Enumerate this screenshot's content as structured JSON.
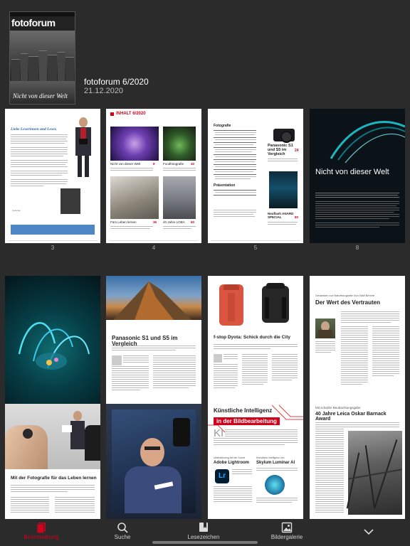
{
  "issue": {
    "title": "fotoforum 6/2020",
    "date": "21.12.2020",
    "cover": {
      "logo": "fotoforum",
      "headline": "Nicht von dieser Welt"
    }
  },
  "pages": [
    {
      "number": "3",
      "heading": "Liebe Leserinnen und Leser,"
    },
    {
      "number": "4",
      "heading": "INHALT 6/2020",
      "captions": [
        "Nicht von dieser Welt",
        "Foodfotografie",
        "Fürs Leben lernen",
        "40 Jahre LOBA"
      ],
      "caption_nums": [
        "8",
        "40",
        "36",
        "60"
      ]
    },
    {
      "number": "5",
      "heading": "Fotografie",
      "side_heading": "Panasonic S1 und S5 im Vergleich",
      "side_num": "24",
      "side_heading2": "Neuflash ANARD SPECIAL",
      "side_num2": "80",
      "sub_heading": "Präsentation"
    },
    {
      "number": "8",
      "heading": "Nicht von dieser Welt"
    },
    {
      "number": "9"
    },
    {
      "number": "24",
      "heading": "Panasonic S1 und S5 im Vergleich"
    },
    {
      "number": "28",
      "heading": "f-stop Dyota: Schick durch die City"
    },
    {
      "number": "30",
      "kicker": "Gedanken zur Naturfotografie Von Niall Benvie",
      "heading": "Der Wert des Vertrauten"
    },
    {
      "number": "",
      "heading": "Mit der Fotografie für das Leben lernen"
    },
    {
      "number": ""
    },
    {
      "number": "",
      "heading": "Künstliche Intelligenz",
      "heading2": "in der Bildbearbeitung",
      "box1": "Unterstützung bei der Suche",
      "box1_title": "Adobe Lightroom",
      "box2": "Künstliche Intelligenz von",
      "box2_title": "Skylum Luminar AI"
    },
    {
      "number": "",
      "kicker": "Mit scharfer Beobachtungsgabe",
      "heading": "40 Jahre Leica Oskar Barnack Award"
    }
  ],
  "tabs": [
    {
      "label": "Beschreibung",
      "icon": "magazine-icon",
      "active": true
    },
    {
      "label": "Suche",
      "icon": "search-icon",
      "active": false
    },
    {
      "label": "Lesezeichen",
      "icon": "bookmark-icon",
      "active": false
    },
    {
      "label": "Bildergalerie",
      "icon": "gallery-icon",
      "active": false
    },
    {
      "label": "",
      "icon": "chevron-down-icon",
      "active": false
    }
  ],
  "colors": {
    "accent": "#d0021b",
    "background": "#2b2b2b"
  }
}
